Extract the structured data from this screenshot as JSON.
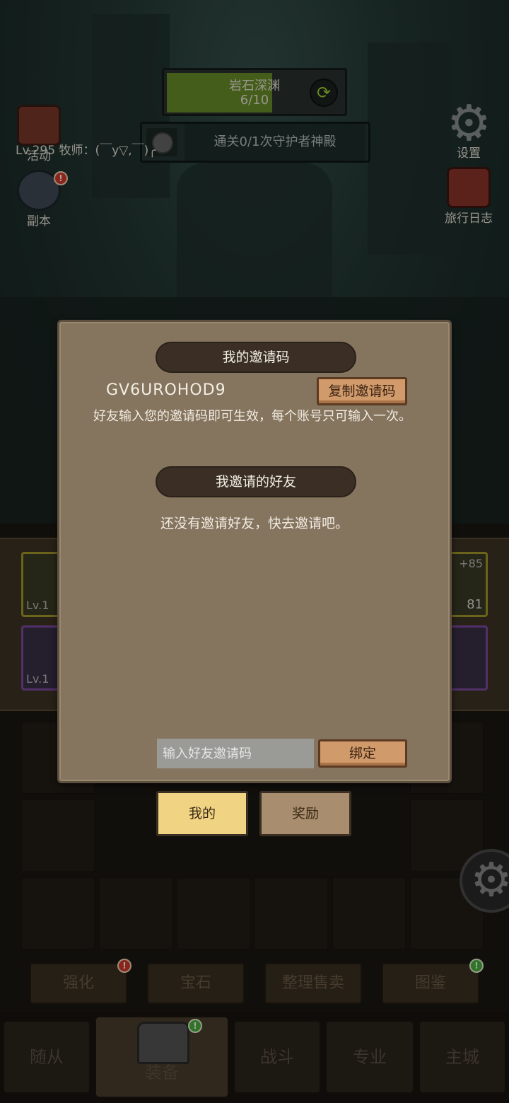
{
  "stage": {
    "name": "岩石深渊",
    "progress": "6/10",
    "progress_fraction": 0.6
  },
  "quest": {
    "text": "通关0/1次守护者神殿"
  },
  "player": {
    "line": "Lv.295 牧师：(￣y▽,￣)╭"
  },
  "left_icons": [
    {
      "label": "活动",
      "icon": "scroll-book-icon"
    },
    {
      "label": "副本",
      "icon": "portal-icon",
      "badge": "!"
    }
  ],
  "right_icons": [
    {
      "label": "设置",
      "icon": "gear-icon"
    },
    {
      "label": "旅行日志",
      "icon": "journal-icon"
    }
  ],
  "equipment": {
    "slots_left": [
      "Lv.1",
      "Lv.1"
    ],
    "slots_right": [
      "+85",
      "81"
    ]
  },
  "dialog": {
    "my_code_title": "我的邀请码",
    "code": "GV6UROHOD9",
    "copy_label": "复制邀请码",
    "description": "好友输入您的邀请码即可生效，每个账号只可输入一次。",
    "friends_title": "我邀请的好友",
    "empty_text": "还没有邀请好友，快去邀请吧。",
    "input_placeholder": "输入好友邀请码",
    "bind_label": "绑定"
  },
  "tabs": {
    "mine": "我的",
    "rewards": "奖励",
    "active": "mine"
  },
  "function_buttons": [
    {
      "label": "强化",
      "badge": "red"
    },
    {
      "label": "宝石"
    },
    {
      "label": "整理售卖"
    },
    {
      "label": "图鉴",
      "badge": "green"
    }
  ],
  "bottom_nav": [
    {
      "label": "随从"
    },
    {
      "label": "装备",
      "active": true,
      "badge": "green"
    },
    {
      "label": "战斗"
    },
    {
      "label": "专业"
    },
    {
      "label": "主城"
    }
  ],
  "colors": {
    "dialog_bg": "#85745e",
    "banner_bg": "#3b2f25",
    "wood_button": "#d19a6a",
    "active_tab": "#f0d383",
    "inactive_tab": "#a88e6e",
    "stage_fill": "#6a8f2a"
  }
}
